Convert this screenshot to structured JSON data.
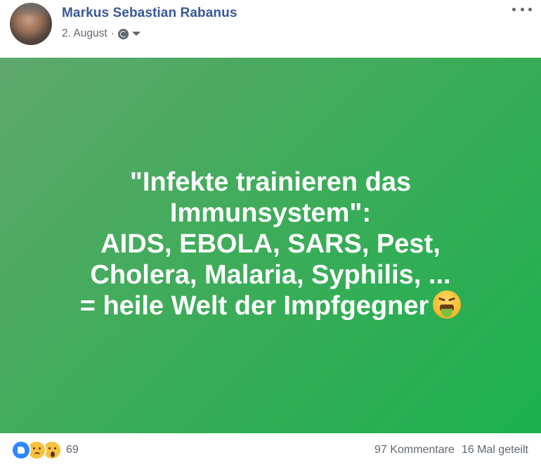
{
  "post": {
    "author": "Markus Sebastian Rabanus",
    "date": "2. August",
    "separator": "·",
    "privacy_icon": "globe-icon",
    "menu_icon": "more-options-icon",
    "content": {
      "background": "#3fac5a",
      "lines": [
        "\"Infekte trainieren das",
        "Immunsystem\":",
        "AIDS, EBOLA, SARS, Pest,",
        "Cholera, Malaria, Syphilis, ...",
        "= heile Welt der Impfgegner"
      ],
      "emoji": "vomiting-face-emoji"
    },
    "reactions": {
      "icons": [
        "like-icon",
        "sad-icon",
        "wow-icon"
      ],
      "count": "69"
    },
    "comments": "97 Kommentare",
    "shares": "16 Mal geteilt"
  }
}
